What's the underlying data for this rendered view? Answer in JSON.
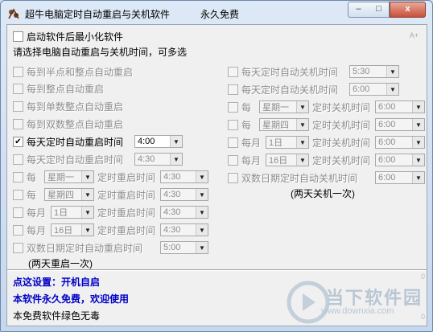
{
  "window": {
    "title": "超牛电脑定时自动重启与关机软件",
    "title_suffix": "永久免费",
    "min_label": "–",
    "max_label": "□",
    "close_label": "x"
  },
  "top": {
    "minimize_start_label": "启动软件后最小化软件",
    "instruction": "请选择电脑自动重启与关机时间，可多选",
    "small_tag": "A+"
  },
  "left": {
    "half_hour": "每到半点和整点自动重启",
    "hour": "每到整点自动重启",
    "odd_hour": "每到单数整点自动重启",
    "even_hour": "每到双数整点自动重启",
    "daily1": {
      "label": "每天定时自动重启时间",
      "value": "4:00",
      "checked_mark": "✔"
    },
    "daily2": {
      "label": "每天定时自动重启时间",
      "value": "4:30"
    },
    "weekly1": {
      "prefix": "每",
      "day": "星期一",
      "label": "定时重启时间",
      "value": "4:30"
    },
    "weekly2": {
      "prefix": "每",
      "day": "星期四",
      "label": "定时重启时间",
      "value": "4:30"
    },
    "monthly1": {
      "prefix": "每月",
      "day": "1日",
      "label": "定时重启时间",
      "value": "4:30"
    },
    "monthly2": {
      "prefix": "每月",
      "day": "16日",
      "label": "定时重启时间",
      "value": "4:30"
    },
    "alt_day": {
      "label": "双数日期定时自动重启时间",
      "value": "5:00",
      "note": "(两天重启一次)"
    }
  },
  "right": {
    "daily1": {
      "label": "每天定时自动关机时间",
      "value": "5:30"
    },
    "daily2": {
      "label": "每天定时自动关机时间",
      "value": "6:00"
    },
    "weekly1": {
      "prefix": "每",
      "day": "星期一",
      "label": "定时关机时间",
      "value": "6:00"
    },
    "weekly2": {
      "prefix": "每",
      "day": "星期四",
      "label": "定时关机时间",
      "value": "6:00"
    },
    "monthly1": {
      "prefix": "每月",
      "day": "1日",
      "label": "定时关机时间",
      "value": "6:00"
    },
    "monthly2": {
      "prefix": "每月",
      "day": "16日",
      "label": "定时关机时间",
      "value": "6:00"
    },
    "alt_day": {
      "label": "双数日期定时自动关机时间",
      "value": "6:00",
      "note": "(两天关机一次)"
    }
  },
  "footer": {
    "settings_link": "点这设置：开机自启",
    "free_msg": "本软件永久免费，欢迎使用",
    "green_msg": "本免费软件绿色无毒",
    "scroll_top": "0",
    "scroll_bottom": "0"
  },
  "watermark": {
    "text": "当下软件园",
    "url": "www.downxia.com"
  }
}
